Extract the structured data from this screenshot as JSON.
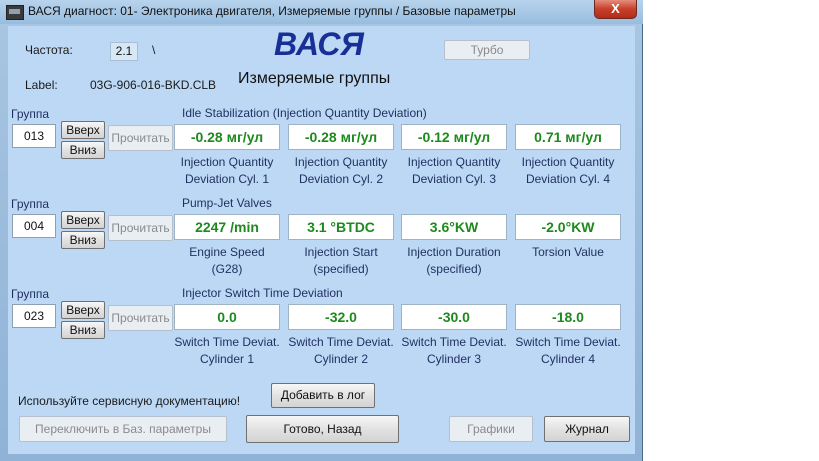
{
  "window": {
    "title": "ВАСЯ диагност: 01- Электроника двигателя,  Измеряемые группы / Базовые параметры",
    "close_label": "X"
  },
  "header": {
    "freq_label": "Частота:",
    "freq_value": "2.1",
    "freq_sep": "\\",
    "brand": "ВАСЯ",
    "turbo_label": "Турбо",
    "label_key": "Label:",
    "label_value": "03G-906-016-BKD.CLB",
    "subtitle": "Измеряемые группы"
  },
  "groups": [
    {
      "group_label": "Группа",
      "number": "013",
      "up": "Вверх",
      "down": "Вниз",
      "read": "Прочитать",
      "title": "Idle Stabilization (Injection Quantity Deviation)",
      "values": [
        "-0.28 мг/ул",
        "-0.28 мг/ул",
        "-0.12 мг/ул",
        "0.71 мг/ул"
      ],
      "captions": [
        [
          "Injection Quantity",
          "Deviation Cyl. 1"
        ],
        [
          "Injection Quantity",
          "Deviation Cyl. 2"
        ],
        [
          "Injection Quantity",
          "Deviation Cyl. 3"
        ],
        [
          "Injection Quantity",
          "Deviation Cyl. 4"
        ]
      ]
    },
    {
      "group_label": "Группа",
      "number": "004",
      "up": "Вверх",
      "down": "Вниз",
      "read": "Прочитать",
      "title": "Pump-Jet Valves",
      "values": [
        "2247 /min",
        "3.1 °BTDC",
        "3.6°KW",
        "-2.0°KW"
      ],
      "captions": [
        [
          "Engine Speed",
          "(G28)"
        ],
        [
          "Injection Start",
          "(specified)"
        ],
        [
          "Injection Duration",
          "(specified)"
        ],
        [
          "Torsion Value",
          ""
        ]
      ]
    },
    {
      "group_label": "Группа",
      "number": "023",
      "up": "Вверх",
      "down": "Вниз",
      "read": "Прочитать",
      "title": "Injector Switch Time Deviation",
      "values": [
        "0.0",
        "-32.0",
        "-30.0",
        "-18.0"
      ],
      "captions": [
        [
          "Switch Time Deviat.",
          "Cylinder 1"
        ],
        [
          "Switch Time Deviat.",
          "Cylinder 2"
        ],
        [
          "Switch Time Deviat.",
          "Cylinder 3"
        ],
        [
          "Switch Time Deviat.",
          "Cylinder 4"
        ]
      ]
    }
  ],
  "footer": {
    "doc_hint": "Используйте сервисную документацию!",
    "add_log": "Добавить в лог",
    "switch_basic": "Переключить в Баз. параметры",
    "done_back": "Готово, Назад",
    "graphs": "Графики",
    "journal": "Журнал"
  }
}
